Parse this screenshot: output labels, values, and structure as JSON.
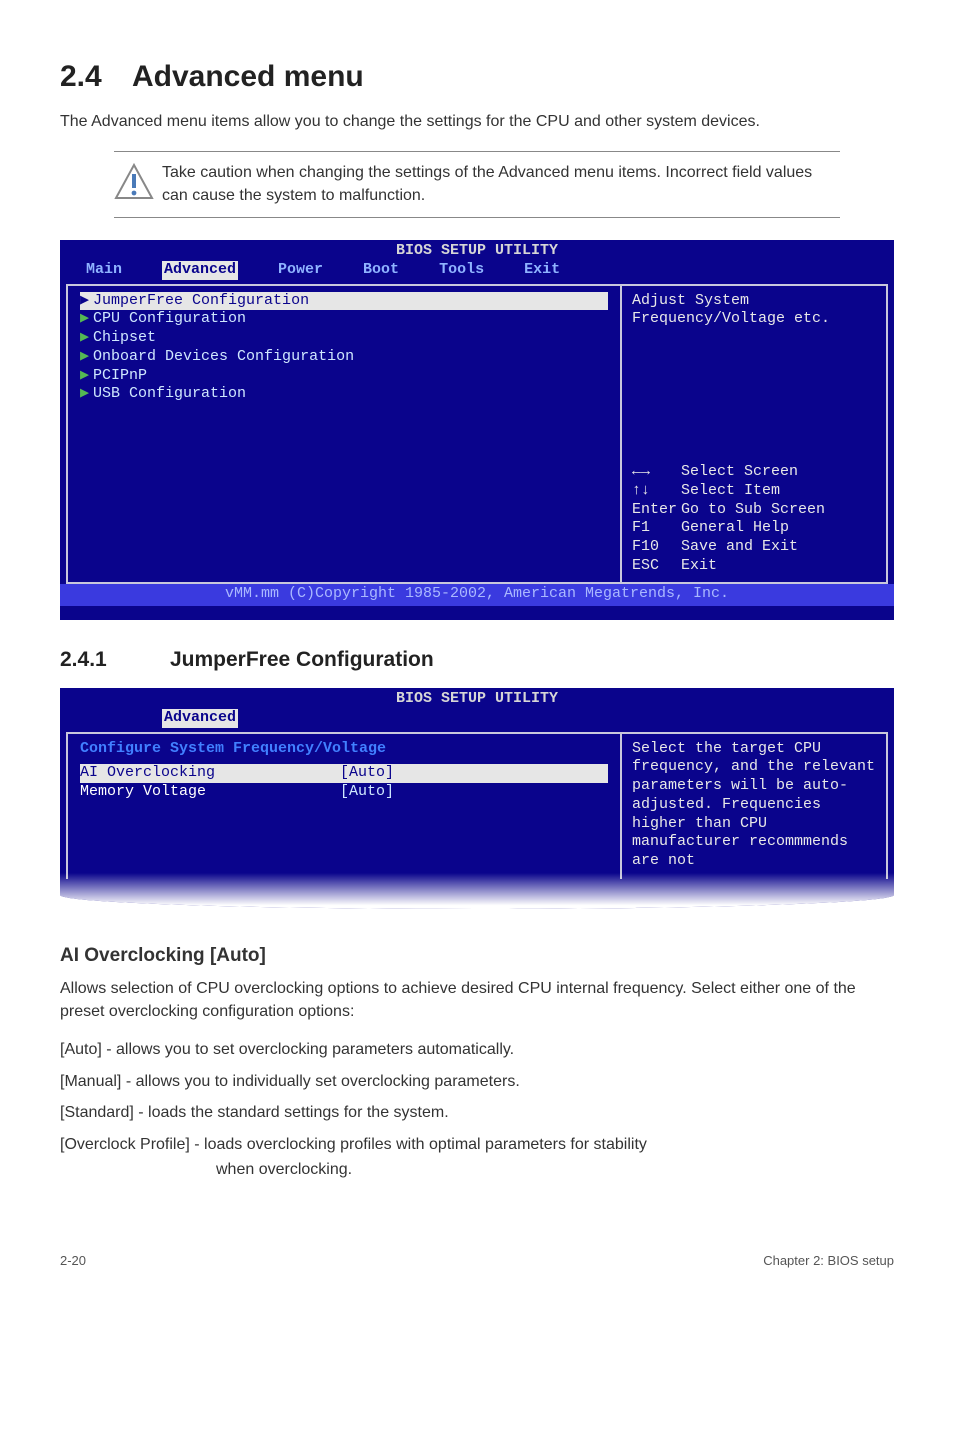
{
  "section": {
    "num": "2.4",
    "title": "Advanced menu"
  },
  "intro": "The Advanced menu items allow you to change the settings for the CPU and other system devices.",
  "note": "Take caution when changing the settings of the Advanced menu items. Incorrect field values can cause the system to malfunction.",
  "bios1": {
    "title": "BIOS SETUP UTILITY",
    "menu": [
      "Main",
      "Advanced",
      "Power",
      "Boot",
      "Tools",
      "Exit"
    ],
    "menu_selected_index": 1,
    "items": [
      "JumperFree Configuration",
      "CPU Configuration",
      "Chipset",
      "Onboard Devices Configuration",
      "PCIPnP",
      "USB Configuration"
    ],
    "items_selected_index": 0,
    "help_top": "Adjust System Frequency/Voltage etc.",
    "help_keys": [
      {
        "k": "←→",
        "d": "Select Screen"
      },
      {
        "k": "↑↓",
        "d": "Select Item"
      },
      {
        "k": "Enter",
        "d": "Go to Sub Screen"
      },
      {
        "k": "F1",
        "d": "General Help"
      },
      {
        "k": "F10",
        "d": "Save and Exit"
      },
      {
        "k": "ESC",
        "d": "Exit"
      }
    ],
    "footer": "vMM.mm (C)Copyright 1985-2002, American Megatrends, Inc."
  },
  "subsection": {
    "num": "2.4.1",
    "title": "JumperFree Configuration"
  },
  "bios2": {
    "title": "BIOS SETUP UTILITY",
    "menu_sel": "Advanced",
    "panel_header": "Configure System Frequency/Voltage",
    "rows": [
      {
        "label": "AI Overclocking",
        "value": "[Auto]"
      },
      {
        "label": "Memory Voltage",
        "value": "[Auto]"
      }
    ],
    "rows_selected_index": 0,
    "help": "Select the target CPU frequency, and the relevant parameters will be auto-adjusted. Frequencies higher than CPU manufacturer recommmends are not"
  },
  "option_block": {
    "heading": "AI Overclocking [Auto]",
    "para": "Allows selection of CPU overclocking options to achieve desired CPU internal frequency. Select either one of the preset overclocking configuration options:",
    "items": [
      {
        "k": "[Auto] -",
        "d": "allows you to set overclocking parameters automatically."
      },
      {
        "k": "[Manual] -",
        "d": "allows you to individually set overclocking parameters."
      },
      {
        "k": "[Standard] -",
        "d": "loads the standard settings for the system."
      },
      {
        "k": "[Overclock Profile] -",
        "d": "loads overclocking profiles with optimal parameters for stability when overclocking."
      }
    ]
  },
  "footer": {
    "left": "2-20",
    "right": "Chapter 2: BIOS setup"
  }
}
